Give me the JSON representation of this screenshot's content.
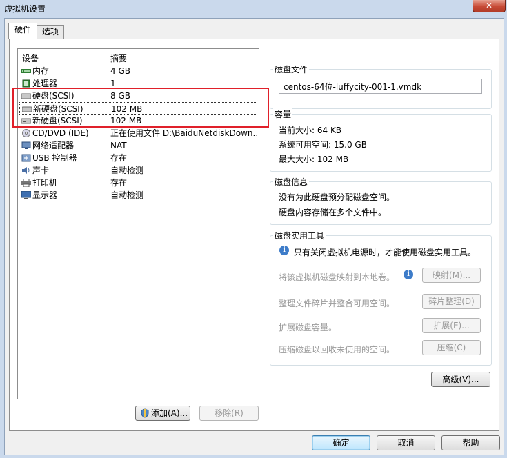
{
  "window": {
    "title": "虚拟机设置",
    "close_glyph": "✕"
  },
  "tabs": [
    {
      "label": "硬件"
    },
    {
      "label": "选项"
    }
  ],
  "device_list": {
    "col_device": "设备",
    "col_summary": "摘要",
    "rows": [
      {
        "name": "内存",
        "summary": "4 GB",
        "icon": "memory-icon"
      },
      {
        "name": "处理器",
        "summary": "1",
        "icon": "cpu-icon"
      },
      {
        "name": "硬盘(SCSI)",
        "summary": "8 GB",
        "icon": "hard-disk-icon"
      },
      {
        "name": "新硬盘(SCSI)",
        "summary": "102 MB",
        "icon": "hard-disk-icon"
      },
      {
        "name": "新硬盘(SCSI)",
        "summary": "102 MB",
        "icon": "hard-disk-icon"
      },
      {
        "name": "CD/DVD (IDE)",
        "summary": "正在使用文件 D:\\BaiduNetdiskDown...",
        "icon": "cd-dvd-icon"
      },
      {
        "name": "网络适配器",
        "summary": "NAT",
        "icon": "network-adapter-icon"
      },
      {
        "name": "USB 控制器",
        "summary": "存在",
        "icon": "usb-icon"
      },
      {
        "name": "声卡",
        "summary": "自动检测",
        "icon": "sound-card-icon"
      },
      {
        "name": "打印机",
        "summary": "存在",
        "icon": "printer-icon"
      },
      {
        "name": "显示器",
        "summary": "自动检测",
        "icon": "display-icon"
      }
    ]
  },
  "disk_file": {
    "title": "磁盘文件",
    "value": "centos-64位-luffycity-001-1.vmdk"
  },
  "capacity": {
    "title": "容量",
    "current_size": "当前大小: 64 KB",
    "available_space": "系统可用空间: 15.0 GB",
    "max_size": "最大大小: 102 MB"
  },
  "disk_info": {
    "title": "磁盘信息",
    "line1": "没有为此硬盘预分配磁盘空间。",
    "line2": "硬盘内容存储在多个文件中。"
  },
  "disk_utilities": {
    "title": "磁盘实用工具",
    "notice": "只有关闭虚拟机电源时，才能使用磁盘实用工具。",
    "map_desc": "将该虚拟机磁盘映射到本地卷。",
    "map_button": "映射(M)...",
    "defrag_desc": "整理文件碎片并整合可用空间。",
    "defrag_button": "碎片整理(D)",
    "expand_desc": "扩展磁盘容量。",
    "expand_button": "扩展(E)...",
    "compact_desc": "压缩磁盘以回收未使用的空间。",
    "compact_button": "压缩(C)"
  },
  "advanced_button": "高级(V)...",
  "add_button": "添加(A)...",
  "remove_button": "移除(R)",
  "footer": {
    "ok": "确定",
    "cancel": "取消",
    "help": "帮助"
  },
  "colors": {
    "highlight_box": "#e0202a",
    "window_frame": "#cad9ec"
  }
}
